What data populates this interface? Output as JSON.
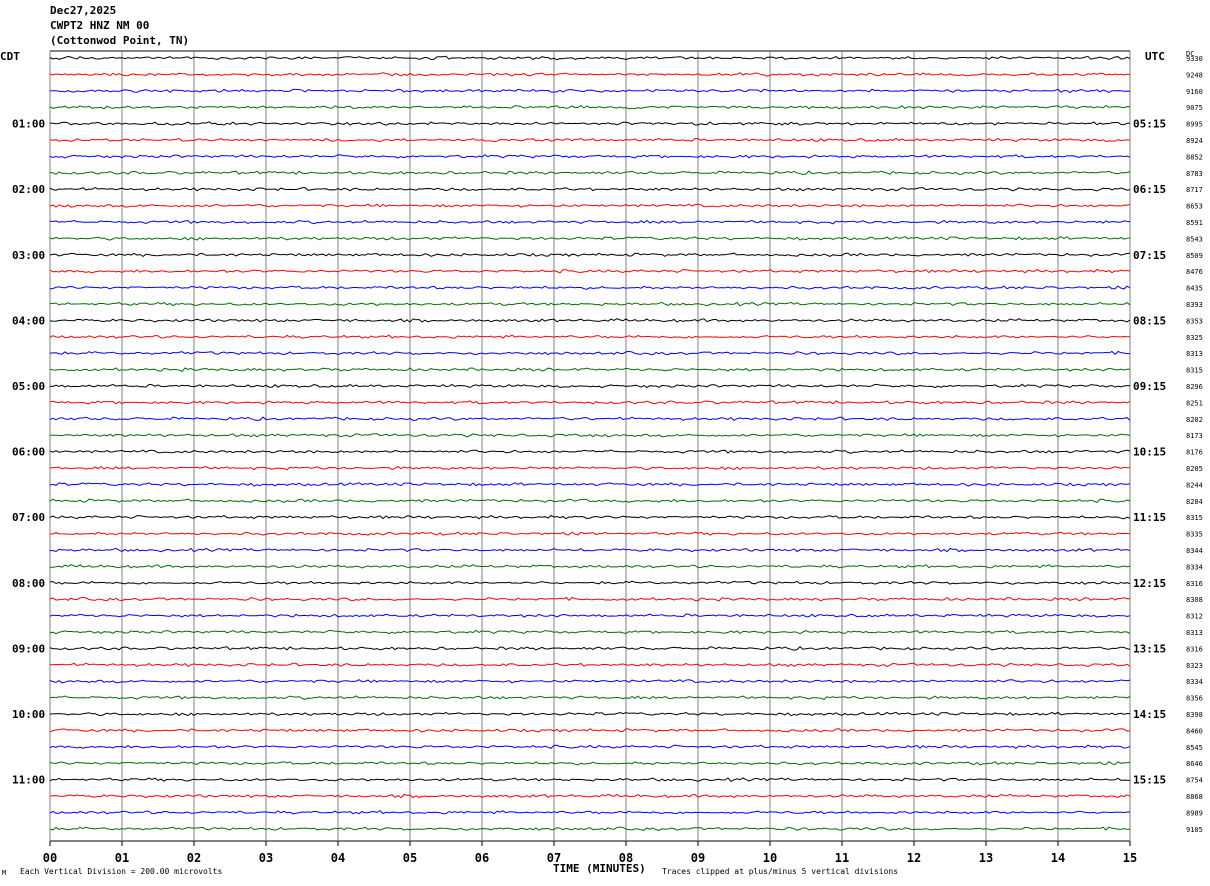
{
  "header": {
    "date": "Dec27,2025",
    "station": "CWPT2 HNZ NM 00",
    "location": "(Cottonwod Point, TN)"
  },
  "left_axis_label": "CDT",
  "right_axis_label": "UTC",
  "dc_label": "DC",
  "footer": {
    "scale_note": "Each Vertical Division =  200.00 microvolts",
    "xlabel": "TIME (MINUTES)",
    "clip_note": "Traces clipped at plus/minus 5 vertical divisions",
    "corner_mark": "M"
  },
  "colors": {
    "trace_cycle": [
      "#000000",
      "#ff0000",
      "#0000ff",
      "#007000"
    ],
    "grid": "#808080"
  },
  "chart_data": {
    "type": "line",
    "title": "CWPT2 HNZ NM 00",
    "xlabel": "TIME (MINUTES)",
    "xlim": [
      0,
      15
    ],
    "x_ticks": [
      "00",
      "01",
      "02",
      "03",
      "04",
      "05",
      "06",
      "07",
      "08",
      "09",
      "10",
      "11",
      "12",
      "13",
      "14",
      "15"
    ],
    "rows": 48,
    "minutes_per_row": 15,
    "cdt_labels": [
      "01:00",
      "02:00",
      "03:00",
      "04:00",
      "05:00",
      "06:00",
      "07:00",
      "08:00",
      "09:00",
      "10:00",
      "11:00"
    ],
    "utc_labels": [
      "05:15",
      "06:15",
      "07:15",
      "08:15",
      "09:15",
      "10:15",
      "11:15",
      "12:15",
      "13:15",
      "14:15",
      "15:15"
    ],
    "dc_offsets": [
      "9330",
      "9248",
      "9160",
      "9075",
      "8995",
      "8924",
      "8852",
      "8783",
      "8717",
      "8653",
      "8591",
      "8543",
      "8509",
      "8476",
      "8435",
      "8393",
      "8353",
      "8325",
      "8313",
      "8315",
      "8296",
      "8251",
      "8202",
      "8173",
      "8176",
      "8205",
      "8244",
      "8284",
      "8315",
      "8335",
      "8344",
      "8334",
      "8316",
      "8308",
      "8312",
      "8313",
      "8316",
      "8323",
      "8334",
      "8356",
      "8398",
      "8460",
      "8545",
      "8646",
      "8754",
      "8868",
      "8989",
      "9105"
    ]
  }
}
